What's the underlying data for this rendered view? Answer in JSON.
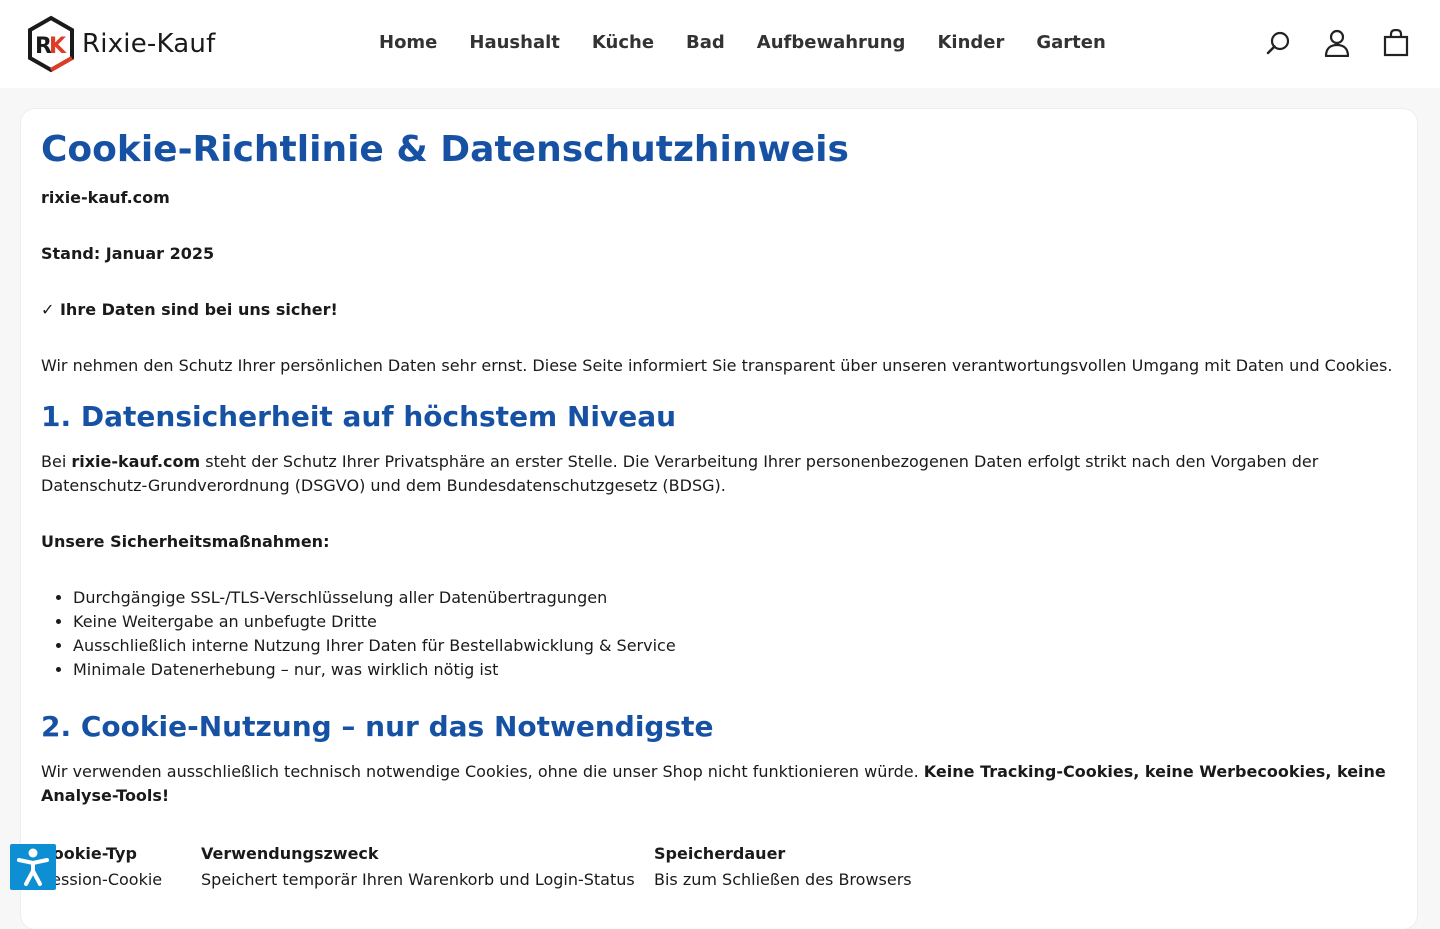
{
  "brand": {
    "name": "Rixie-Kauf",
    "logo_letters": "RK"
  },
  "nav": {
    "items": [
      "Home",
      "Haushalt",
      "Küche",
      "Bad",
      "Aufbewahrung",
      "Kinder",
      "Garten"
    ]
  },
  "header_icons": [
    "search-icon",
    "account-icon",
    "cart-icon"
  ],
  "page": {
    "title": "Cookie-Richtlinie & Datenschutzhinweis",
    "domain": "rixie-kauf.com",
    "stand": "Stand: Januar 2025",
    "safe_line": "✓ Ihre Daten sind bei uns sicher!",
    "intro": "Wir nehmen den Schutz Ihrer persönlichen Daten sehr ernst. Diese Seite informiert Sie transparent über unseren verantwortungsvollen Umgang mit Daten und Cookies.",
    "section1": {
      "heading": "1. Datensicherheit auf höchstem Niveau",
      "p_before": "Bei ",
      "p_bold": "rixie-kauf.com",
      "p_after": " steht der Schutz Ihrer Privatsphäre an erster Stelle. Die Verarbeitung Ihrer personenbezogenen Daten erfolgt strikt nach den Vorgaben der Datenschutz-Grundverordnung (DSGVO) und dem Bundesdatenschutzgesetz (BDSG).",
      "measures_heading": "Unsere Sicherheitsmaßnahmen:",
      "measures": [
        "Durchgängige SSL-/TLS-Verschlüsselung aller Datenübertragungen",
        "Keine Weitergabe an unbefugte Dritte",
        "Ausschließlich interne Nutzung Ihrer Daten für Bestellabwicklung & Service",
        "Minimale Datenerhebung – nur, was wirklich nötig ist"
      ]
    },
    "section2": {
      "heading": "2. Cookie-Nutzung – nur das Notwendigste",
      "p_normal": "Wir verwenden ausschließlich technisch notwendige Cookies, ohne die unser Shop nicht funktionieren würde. ",
      "p_bold": "Keine Tracking-Cookies, keine Werbecookies, keine Analyse-Tools!",
      "table": {
        "headers": [
          "Cookie-Typ",
          "Verwendungszweck",
          "Speicherdauer"
        ],
        "rows": [
          [
            "Session-Cookie",
            "Speichert temporär Ihren Warenkorb und Login-Status",
            "Bis zum Schließen des Browsers"
          ]
        ]
      }
    }
  },
  "accessibility_button": "accessibility-icon",
  "colors": {
    "heading": "#1651a3",
    "logo_red": "#e03b24",
    "a11y": "#0f8fd3"
  }
}
